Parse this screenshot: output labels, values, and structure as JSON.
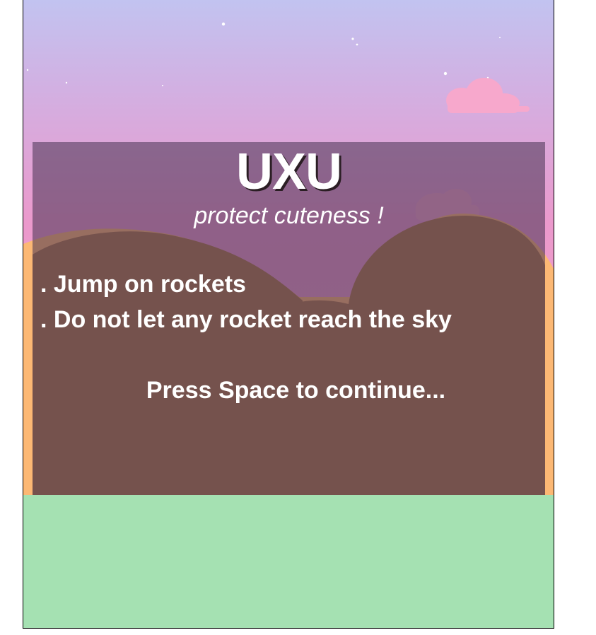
{
  "game": {
    "title": "UXU",
    "subtitle": "protect cuteness !",
    "rules": [
      ". Jump on rockets",
      ". Do not let any rocket reach the sky"
    ],
    "prompt": "Press Space to continue..."
  },
  "colors": {
    "sky_top": "#c2c3f0",
    "sky_mid": "#dcadd9",
    "sky_bottom": "#ec94c9",
    "cloud": "#f7a8cc",
    "hills_back": "#fcb874",
    "hills_front": "#b07a4a",
    "ground": "#a5e1b2",
    "overlay": "#46325a",
    "star": "#ffffff"
  }
}
